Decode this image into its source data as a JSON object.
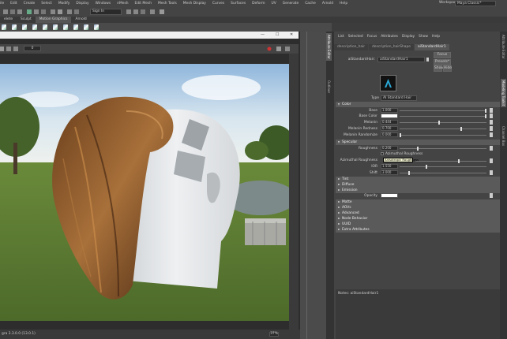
{
  "menubar": {
    "items": [
      "ile",
      "Edit",
      "Create",
      "Select",
      "Modify",
      "Display",
      "Windows",
      "nMesh",
      "Edit Mesh",
      "Mesh Tools",
      "Mesh Display",
      "Curves",
      "Surfaces",
      "Deform",
      "UV",
      "Generate",
      "Cache",
      "Arnold",
      "Help"
    ],
    "workspace_label": "Workspace :",
    "workspace_value": "Maya Classic*"
  },
  "toolbar": {
    "signin": "Sign In"
  },
  "shelf_tabs": [
    "elete",
    "Sculpt",
    "Motion Graphics",
    "Arnold"
  ],
  "viewer": {
    "frame_value": "0"
  },
  "status_text": "gra 3.3.0.0 (13.0.1)",
  "zoom_text": "37%",
  "ae": {
    "menu": [
      "List",
      "Selected",
      "Focus",
      "Attributes",
      "Display",
      "Show",
      "Help"
    ],
    "tabs": [
      "description_hair",
      "description_hairShape",
      "aiStandardHair1"
    ],
    "node_label": "aiStandardHair:",
    "node_value": "aiStandardHair1",
    "focus_button": "Focus",
    "presets_button": "Presets*",
    "show_button": "Show",
    "hide_button": "Hide",
    "type_label": "Type",
    "type_value": "AI Standard Hair",
    "sections": {
      "color": "Color",
      "specular": "Specular",
      "tint": "Tint",
      "diffuse": "Diffuse",
      "emission": "Emission",
      "matte": "Matte",
      "aovs": "AOVs",
      "advanced": "Advanced",
      "node_behavior": "Node Behavior",
      "uuid": "UUID",
      "extra": "Extra Attributes"
    },
    "color_rows": [
      {
        "label": "Base",
        "value": "1.000",
        "level": 1.0
      },
      {
        "label": "Base Color",
        "value": "",
        "level": 1.0
      },
      {
        "label": "Melanin",
        "value": "0.444",
        "level": 0.444
      },
      {
        "label": "Melanin Redness",
        "value": "0.700",
        "level": 0.7
      },
      {
        "label": "Melanin Randomize",
        "value": "0.000",
        "level": 0.0
      }
    ],
    "specular_rows": [
      {
        "label": "Roughness",
        "value": "0.200",
        "level": 0.2
      },
      {
        "label": "Azimuthal Roughness",
        "value": "",
        "level": 0.6
      },
      {
        "label": "IOR",
        "value": "1.550",
        "level": 0.3
      },
      {
        "label": "Shift",
        "value": "3.000",
        "level": 0.1
      }
    ],
    "specular_check": "Azimuthal Roughness",
    "tooltip": "Anisotropic Roughness",
    "emission_row": {
      "label": "Opacity"
    },
    "notes": "Notes: aiStandardHair1"
  },
  "side_tabs": {
    "left": [
      "Attribute Editor",
      "Outliner"
    ],
    "right": [
      "Attribute Editor",
      "Modeling Toolkit",
      "Channel Box",
      "Layer Editor"
    ]
  },
  "colors": {
    "accent": "#2aa8d6",
    "base_color": "#ffffff"
  }
}
